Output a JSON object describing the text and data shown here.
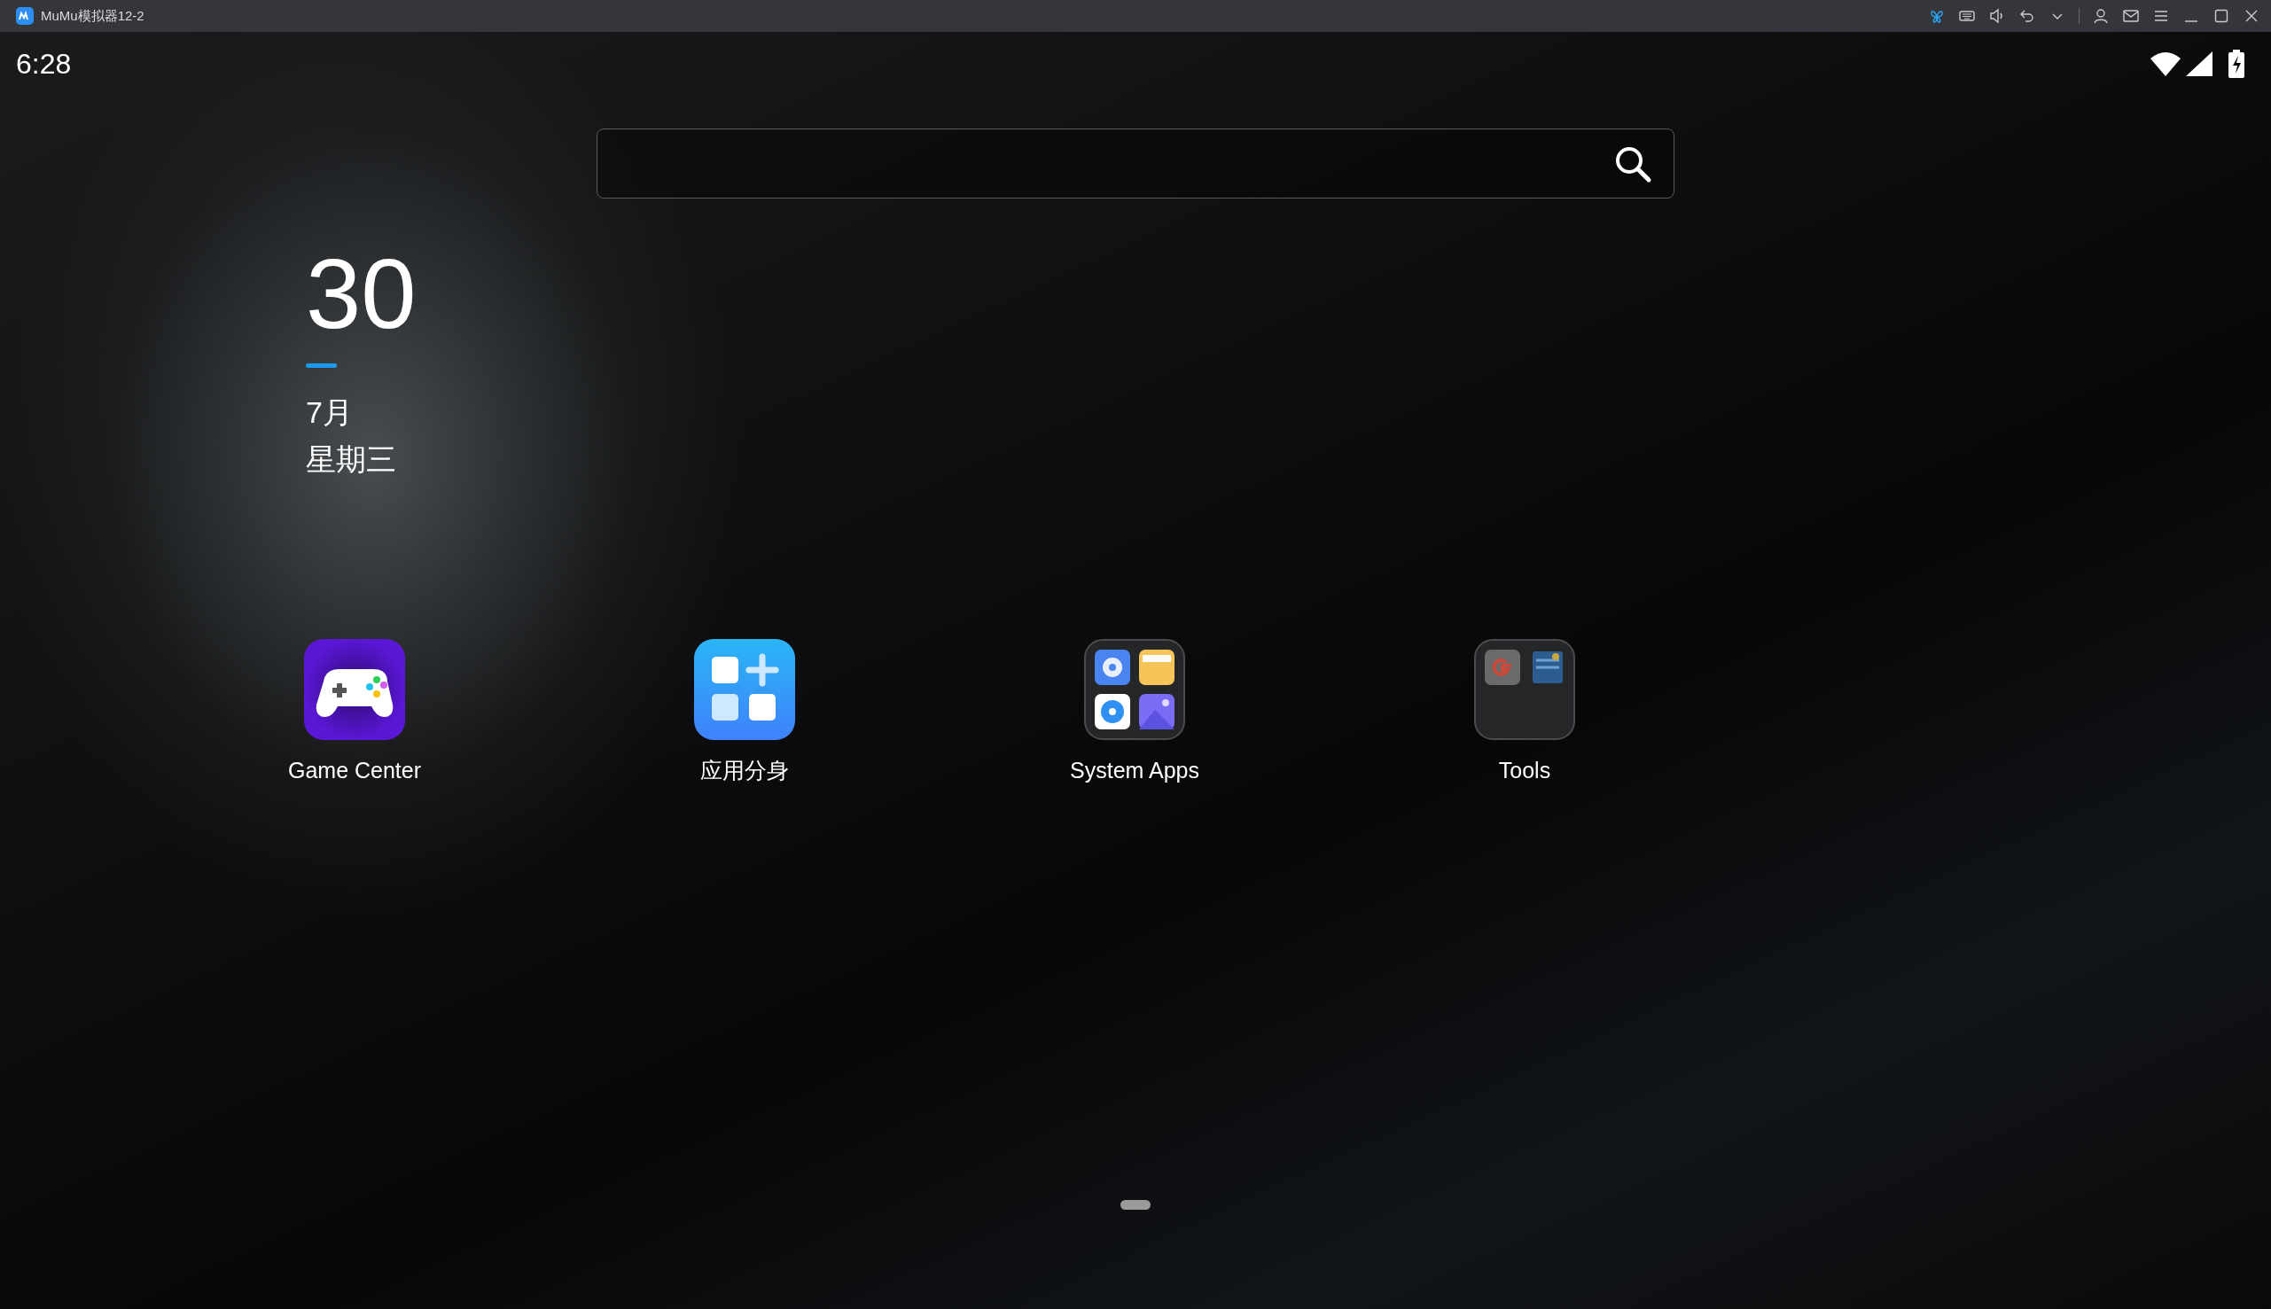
{
  "window": {
    "title": "MuMu模拟器12-2"
  },
  "status_bar": {
    "time": "6:28"
  },
  "date_widget": {
    "day": "30",
    "month": "7月",
    "weekday": "星期三"
  },
  "apps": [
    {
      "kind": "gamepad",
      "label": "Game Center"
    },
    {
      "kind": "clone",
      "label": "应用分身"
    },
    {
      "kind": "system-folder",
      "label": "System Apps"
    },
    {
      "kind": "tools-folder",
      "label": "Tools"
    }
  ],
  "pages": [
    {
      "selected": true
    }
  ]
}
